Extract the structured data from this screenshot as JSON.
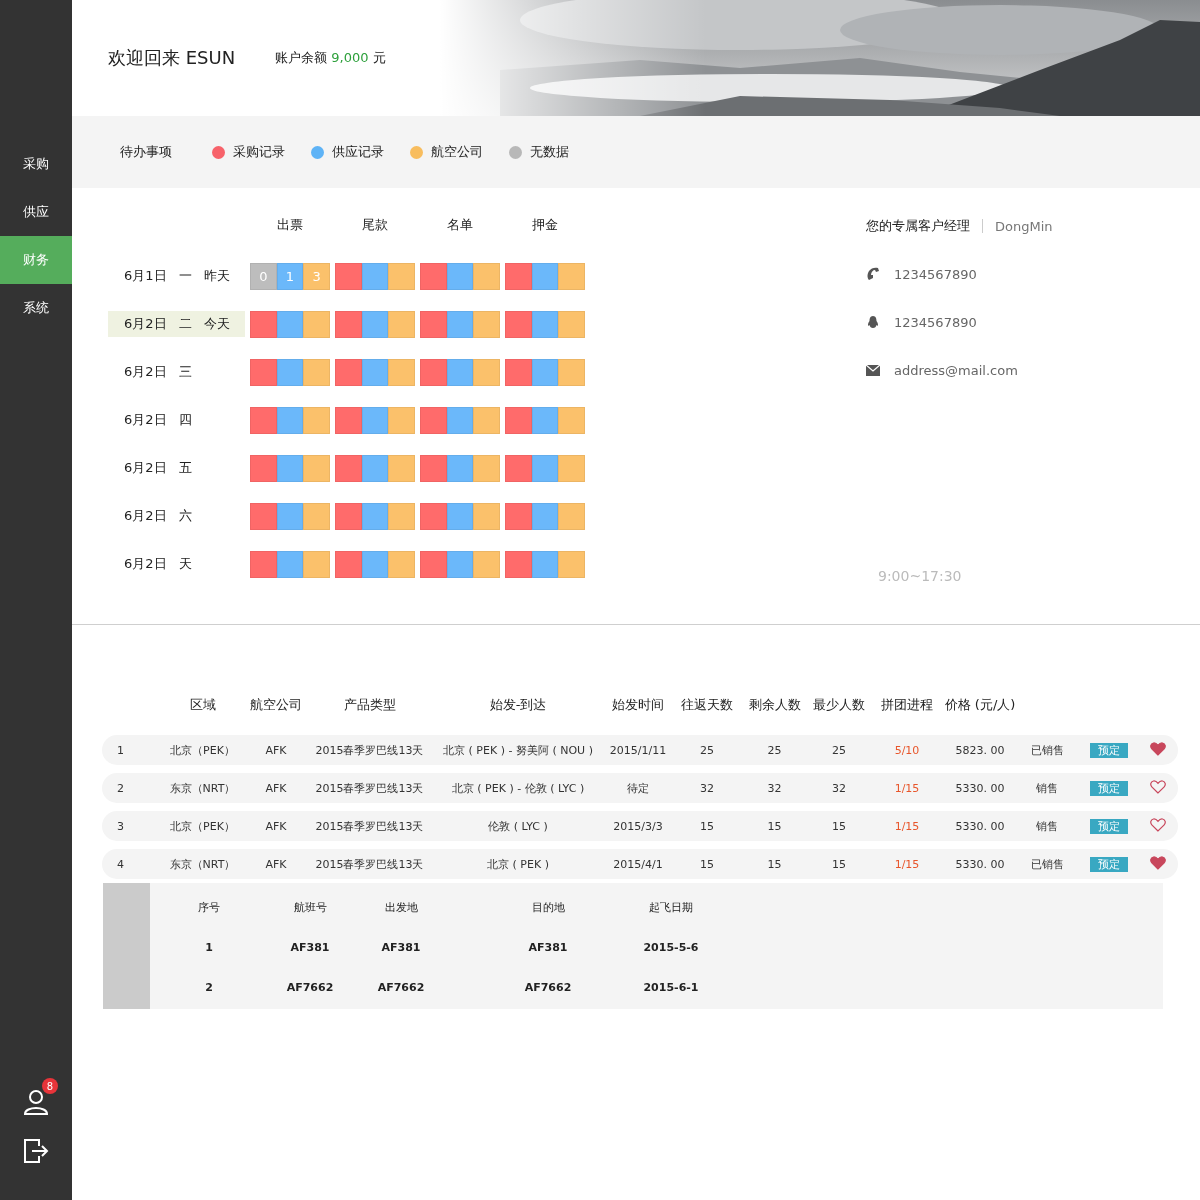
{
  "sidebar": {
    "items": [
      {
        "label": "采购",
        "selected": false
      },
      {
        "label": "供应",
        "selected": false
      },
      {
        "label": "财务",
        "selected": true
      },
      {
        "label": "系统",
        "selected": false
      }
    ],
    "badge": "8"
  },
  "header": {
    "welcome": "欢迎回来 ESUN",
    "balance_label": "账户余额",
    "balance": "9,000",
    "currency": "元"
  },
  "legend": {
    "title": "待办事项",
    "items": [
      {
        "label": "采购记录",
        "color": "#f7626a"
      },
      {
        "label": "供应记录",
        "color": "#5eb3f6"
      },
      {
        "label": "航空公司",
        "color": "#f8bd5e"
      },
      {
        "label": "无数据",
        "color": "#b8b8b8"
      }
    ]
  },
  "calendar": {
    "columns": [
      "出票",
      "尾款",
      "名单",
      "押金"
    ],
    "rows": [
      {
        "date": "6月1日",
        "weekday": "一",
        "note": "昨天",
        "selected": false,
        "groups": [
          {
            "cells": [
              {
                "color": "#bdbdbd",
                "text": "0"
              },
              {
                "color": "#6bb8fa",
                "text": "1"
              },
              {
                "color": "#fbc16b",
                "text": "3"
              }
            ]
          },
          {
            "cells": [
              {
                "color": "#ff6b6b"
              },
              {
                "color": "#6bb8fa"
              },
              {
                "color": "#fbc16b"
              }
            ]
          },
          {
            "cells": [
              {
                "color": "#ff6b6b"
              },
              {
                "color": "#6bb8fa"
              },
              {
                "color": "#fbc16b"
              }
            ]
          },
          {
            "cells": [
              {
                "color": "#ff6b6b"
              },
              {
                "color": "#6bb8fa"
              },
              {
                "color": "#fbc16b"
              }
            ]
          }
        ]
      },
      {
        "date": "6月2日",
        "weekday": "二",
        "note": "今天",
        "selected": true,
        "groups": [
          {
            "cells": [
              {
                "color": "#ff6b6b"
              },
              {
                "color": "#6bb8fa"
              },
              {
                "color": "#fbc16b"
              }
            ]
          },
          {
            "cells": [
              {
                "color": "#ff6b6b"
              },
              {
                "color": "#6bb8fa"
              },
              {
                "color": "#fbc16b"
              }
            ]
          },
          {
            "cells": [
              {
                "color": "#ff6b6b"
              },
              {
                "color": "#6bb8fa"
              },
              {
                "color": "#fbc16b"
              }
            ]
          },
          {
            "cells": [
              {
                "color": "#ff6b6b"
              },
              {
                "color": "#6bb8fa"
              },
              {
                "color": "#fbc16b"
              }
            ]
          }
        ]
      },
      {
        "date": "6月2日",
        "weekday": "三",
        "selected": false,
        "groups": [
          {
            "cells": [
              {
                "color": "#ff6b6b"
              },
              {
                "color": "#6bb8fa"
              },
              {
                "color": "#fbc16b"
              }
            ]
          },
          {
            "cells": [
              {
                "color": "#ff6b6b"
              },
              {
                "color": "#6bb8fa"
              },
              {
                "color": "#fbc16b"
              }
            ]
          },
          {
            "cells": [
              {
                "color": "#ff6b6b"
              },
              {
                "color": "#6bb8fa"
              },
              {
                "color": "#fbc16b"
              }
            ]
          },
          {
            "cells": [
              {
                "color": "#ff6b6b"
              },
              {
                "color": "#6bb8fa"
              },
              {
                "color": "#fbc16b"
              }
            ]
          }
        ]
      },
      {
        "date": "6月2日",
        "weekday": "四",
        "selected": false,
        "groups": [
          {
            "cells": [
              {
                "color": "#ff6b6b"
              },
              {
                "color": "#6bb8fa"
              },
              {
                "color": "#fbc16b"
              }
            ]
          },
          {
            "cells": [
              {
                "color": "#ff6b6b"
              },
              {
                "color": "#6bb8fa"
              },
              {
                "color": "#fbc16b"
              }
            ]
          },
          {
            "cells": [
              {
                "color": "#ff6b6b"
              },
              {
                "color": "#6bb8fa"
              },
              {
                "color": "#fbc16b"
              }
            ]
          },
          {
            "cells": [
              {
                "color": "#ff6b6b"
              },
              {
                "color": "#6bb8fa"
              },
              {
                "color": "#fbc16b"
              }
            ]
          }
        ]
      },
      {
        "date": "6月2日",
        "weekday": "五",
        "selected": false,
        "groups": [
          {
            "cells": [
              {
                "color": "#ff6b6b"
              },
              {
                "color": "#6bb8fa"
              },
              {
                "color": "#fbc16b"
              }
            ]
          },
          {
            "cells": [
              {
                "color": "#ff6b6b"
              },
              {
                "color": "#6bb8fa"
              },
              {
                "color": "#fbc16b"
              }
            ]
          },
          {
            "cells": [
              {
                "color": "#ff6b6b"
              },
              {
                "color": "#6bb8fa"
              },
              {
                "color": "#fbc16b"
              }
            ]
          },
          {
            "cells": [
              {
                "color": "#ff6b6b"
              },
              {
                "color": "#6bb8fa"
              },
              {
                "color": "#fbc16b"
              }
            ]
          }
        ]
      },
      {
        "date": "6月2日",
        "weekday": "六",
        "selected": false,
        "groups": [
          {
            "cells": [
              {
                "color": "#ff6b6b"
              },
              {
                "color": "#6bb8fa"
              },
              {
                "color": "#fbc16b"
              }
            ]
          },
          {
            "cells": [
              {
                "color": "#ff6b6b"
              },
              {
                "color": "#6bb8fa"
              },
              {
                "color": "#fbc16b"
              }
            ]
          },
          {
            "cells": [
              {
                "color": "#ff6b6b"
              },
              {
                "color": "#6bb8fa"
              },
              {
                "color": "#fbc16b"
              }
            ]
          },
          {
            "cells": [
              {
                "color": "#ff6b6b"
              },
              {
                "color": "#6bb8fa"
              },
              {
                "color": "#fbc16b"
              }
            ]
          }
        ]
      },
      {
        "date": "6月2日",
        "weekday": "天",
        "selected": false,
        "groups": [
          {
            "cells": [
              {
                "color": "#ff6b6b"
              },
              {
                "color": "#6bb8fa"
              },
              {
                "color": "#fbc16b"
              }
            ]
          },
          {
            "cells": [
              {
                "color": "#ff6b6b"
              },
              {
                "color": "#6bb8fa"
              },
              {
                "color": "#fbc16b"
              }
            ]
          },
          {
            "cells": [
              {
                "color": "#ff6b6b"
              },
              {
                "color": "#6bb8fa"
              },
              {
                "color": "#fbc16b"
              }
            ]
          },
          {
            "cells": [
              {
                "color": "#ff6b6b"
              },
              {
                "color": "#6bb8fa"
              },
              {
                "color": "#fbc16b"
              }
            ]
          }
        ]
      }
    ]
  },
  "manager": {
    "title": "您的专属客户经理",
    "name": "DongMin",
    "contacts": [
      {
        "kind": "phone",
        "text": "1234567890"
      },
      {
        "kind": "qq",
        "text": "1234567890"
      },
      {
        "kind": "email",
        "text": "address@mail.com"
      }
    ],
    "hours": "9:00~17:30"
  },
  "table": {
    "columns": [
      "",
      "区域",
      "航空公司",
      "产品类型",
      "始发-到达",
      "始发时间",
      "往返天数",
      "剩余人数",
      "最少人数",
      "拼团进程",
      "价格 (元/人)"
    ],
    "rows": [
      {
        "cells": [
          "1",
          "北京（PEK）",
          "AFK",
          "2015春季罗巴线13天",
          "北京 ( PEK ) - 努美阿 ( NOU )",
          "2015/1/11",
          "25",
          "25",
          "25",
          "5/10",
          "5823. 00"
        ],
        "status": "已销售",
        "action": "预定",
        "favorite": true
      },
      {
        "cells": [
          "2",
          "东京（NRT）",
          "AFK",
          "2015春季罗巴线13天",
          "北京 ( PEK ) - 伦敦 ( LYC )",
          "待定",
          "32",
          "32",
          "32",
          "1/15",
          "5330. 00"
        ],
        "status": "销售",
        "action": "预定",
        "favorite": false
      },
      {
        "cells": [
          "3",
          "北京（PEK）",
          "AFK",
          "2015春季罗巴线13天",
          "伦敦 ( LYC )",
          "2015/3/3",
          "15",
          "15",
          "15",
          "1/15",
          "5330. 00"
        ],
        "status": "销售",
        "action": "预定",
        "favorite": false
      },
      {
        "cells": [
          "4",
          "东京（NRT）",
          "AFK",
          "2015春季罗巴线13天",
          "北京 ( PEK )",
          "2015/4/1",
          "15",
          "15",
          "15",
          "1/15",
          "5330. 00"
        ],
        "status": "已销售",
        "action": "预定",
        "favorite": true
      }
    ]
  },
  "subtable": {
    "columns": [
      "序号",
      "航班号",
      "出发地",
      "目的地",
      "起飞日期"
    ],
    "rows": [
      [
        "1",
        "AF381",
        "AF381",
        "AF381",
        "2015-5-6"
      ],
      [
        "2",
        "AF7662",
        "AF7662",
        "AF7662",
        "2015-6-1"
      ]
    ]
  }
}
